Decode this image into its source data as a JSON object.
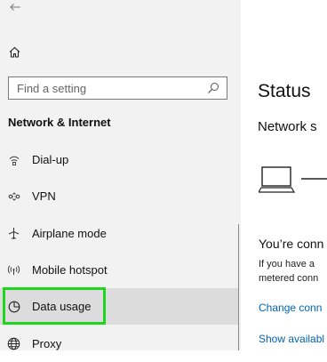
{
  "sidebar": {
    "back_icon": "back-arrow-icon",
    "home_icon": "home-icon",
    "search": {
      "placeholder": "Find a setting",
      "icon": "search-icon"
    },
    "section_title": "Network & Internet",
    "items": [
      {
        "label": "Dial-up",
        "icon": "dialup-icon",
        "selected": false
      },
      {
        "label": "VPN",
        "icon": "vpn-icon",
        "selected": false
      },
      {
        "label": "Airplane mode",
        "icon": "airplane-icon",
        "selected": false
      },
      {
        "label": "Mobile hotspot",
        "icon": "hotspot-icon",
        "selected": false
      },
      {
        "label": "Data usage",
        "icon": "data-usage-icon",
        "selected": true
      },
      {
        "label": "Proxy",
        "icon": "globe-icon",
        "selected": false
      }
    ]
  },
  "main": {
    "title": "Status",
    "network_status": "Network s",
    "connected_heading": "You’re conn",
    "desc_line1": "If you have a",
    "desc_line2": "metered conn",
    "link1": "Change conn",
    "link2": "Show availabl"
  },
  "colors": {
    "sidebar_bg": "#f2f2f2",
    "selected_bg": "#dcdcdc",
    "highlight": "#1fd61f",
    "link": "#0063b1"
  }
}
